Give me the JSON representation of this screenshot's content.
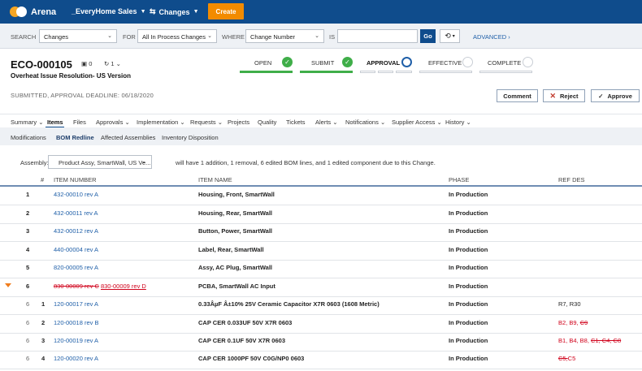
{
  "topbar": {
    "logo": "Arena",
    "workspace": "_EveryHome Sales",
    "changes_menu": "Changes",
    "create_label": "Create"
  },
  "search": {
    "search_label": "SEARCH",
    "search_value": "Changes",
    "for_label": "FOR",
    "for_value": "All In Process Changes",
    "where_label": "WHERE",
    "where_value": "Change Number",
    "is_label": "IS",
    "is_value": "",
    "go_label": "Go",
    "advanced_label": "ADVANCED"
  },
  "header": {
    "number": "ECO-000105",
    "attachments_count": "0",
    "revision_count": "1",
    "subtitle": "Overheat Issue Resolution- US Version",
    "deadline": "SUBMITTED, APPROVAL DEADLINE: 06/18/2020"
  },
  "progress": {
    "stages": [
      "OPEN",
      "SUBMIT",
      "APPROVAL",
      "EFFECTIVE",
      "COMPLETE"
    ],
    "colors": {
      "done": "#3fae49",
      "current": "#1f5fa8",
      "pending": "#c9ced5"
    }
  },
  "actions": {
    "comment": "Comment",
    "reject": "Reject",
    "approve": "Approve"
  },
  "tabs": [
    "Summary",
    "Items",
    "Files",
    "Approvals",
    "Implementation",
    "Requests",
    "Projects",
    "Quality",
    "Tickets",
    "Alerts",
    "Notifications",
    "Supplier Access",
    "History"
  ],
  "active_tab": "Items",
  "subtabs": [
    "Modifications",
    "BOM Redline",
    "Affected Assemblies",
    "Inventory Disposition"
  ],
  "active_subtab": "BOM Redline",
  "assembly": {
    "label": "Assembly:",
    "value": "Product Assy, SmartWall, US Ve...",
    "message": "will have 1 addition, 1 removal, 6 edited BOM lines, and 1 edited component due to this Change."
  },
  "table": {
    "columns": [
      "#",
      "ITEM NUMBER",
      "ITEM NAME",
      "PHASE",
      "REF DES"
    ],
    "rows": [
      {
        "num": "1",
        "item": "432-00010 rev A",
        "name": "Housing, Front, SmartWall",
        "phase": "In Production"
      },
      {
        "num": "2",
        "item": "432-00011 rev A",
        "name": "Housing, Rear, SmartWall",
        "phase": "In Production"
      },
      {
        "num": "3",
        "item": "432-00012 rev A",
        "name": "Button, Power, SmartWall",
        "phase": "In Production"
      },
      {
        "num": "4",
        "item": "440-00004 rev A",
        "name": "Label, Rear, SmartWall",
        "phase": "In Production"
      },
      {
        "num": "5",
        "item": "820-00005 rev A",
        "name": "Assy, AC Plug, SmartWall",
        "phase": "In Production"
      },
      {
        "num": "6",
        "item_old": "830-00009 rev C",
        "item_new": "830-00009 rev D",
        "name": "PCBA, SmartWall AC Input",
        "phase": "In Production"
      },
      {
        "parent": "6",
        "num": "1",
        "item": "120-00017 rev A",
        "name": "0.33ÂµF Â±10% 25V Ceramic Capacitor X7R 0603 (1608 Metric)",
        "phase": "In Production",
        "ref": "R7, R30"
      },
      {
        "parent": "6",
        "num": "2",
        "item": "120-00018 rev B",
        "name": "CAP CER 0.033UF 50V X7R 0603",
        "phase": "In Production",
        "ref_new": "B2, B9,",
        "ref_old": "C9"
      },
      {
        "parent": "6",
        "num": "3",
        "item": "120-00019 rev A",
        "name": "CAP CER 0.1UF 50V X7R 0603",
        "phase": "In Production",
        "ref_new": "B1, B4, B8,",
        "ref_old": "C1, C4, C8"
      },
      {
        "parent": "6",
        "num": "4",
        "item": "120-00020 rev A",
        "name": "CAP CER 1000PF 50V C0G/NP0 0603",
        "phase": "In Production",
        "ref_old": "C5,",
        "ref_new": "C5"
      }
    ]
  }
}
